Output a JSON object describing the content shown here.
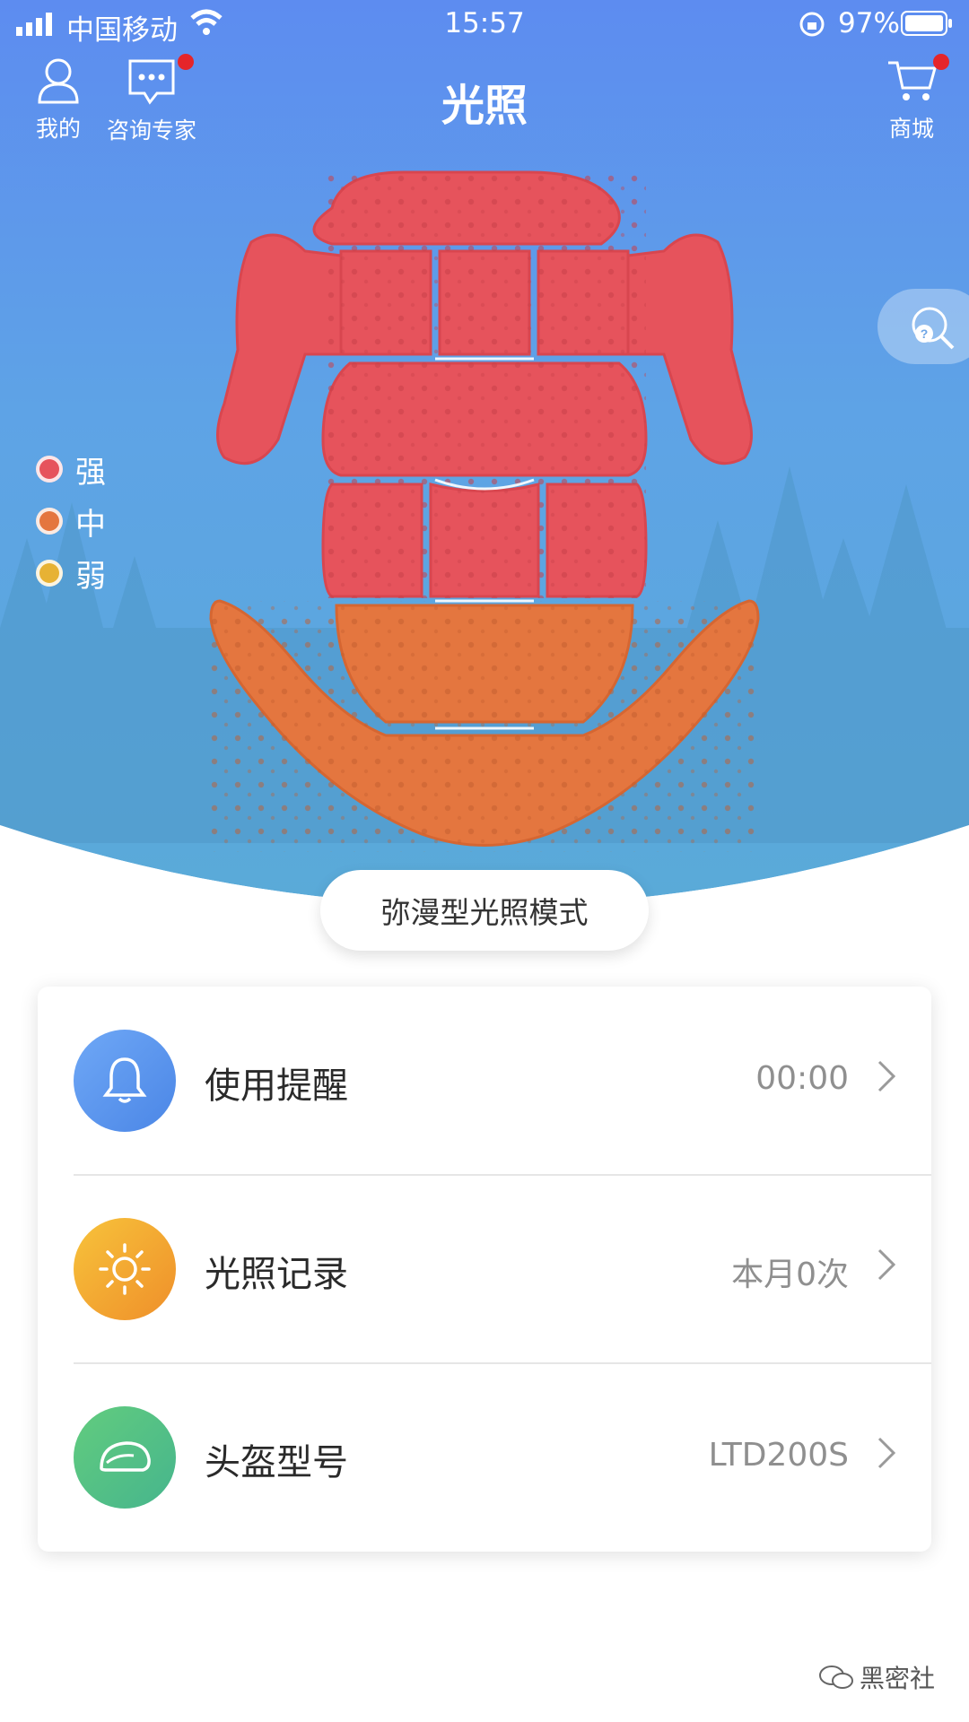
{
  "status_bar": {
    "carrier": "中国移动",
    "time": "15:57",
    "battery": "97%"
  },
  "nav": {
    "profile_label": "我的",
    "consult_label": "咨询专家",
    "title": "光照",
    "shop_label": "商城"
  },
  "legend": [
    {
      "label": "强",
      "color": "#e6535c"
    },
    {
      "label": "中",
      "color": "#e4763f"
    },
    {
      "label": "弱",
      "color": "#e7b234"
    }
  ],
  "mode_label": "弥漫型光照模式",
  "menu": [
    {
      "title": "使用提醒",
      "value": "00:00",
      "icon": "bell-icon",
      "color": "#5b96ee"
    },
    {
      "title": "光照记录",
      "value": "本月0次",
      "icon": "sun-icon",
      "color": "#f2a630"
    },
    {
      "title": "头盔型号",
      "value": "LTD200S",
      "icon": "helmet-icon",
      "color": "#53c27f"
    }
  ],
  "zones": {
    "strong_color": "#e6535c",
    "medium_color": "#e4763f"
  },
  "watermark": "黑密社"
}
